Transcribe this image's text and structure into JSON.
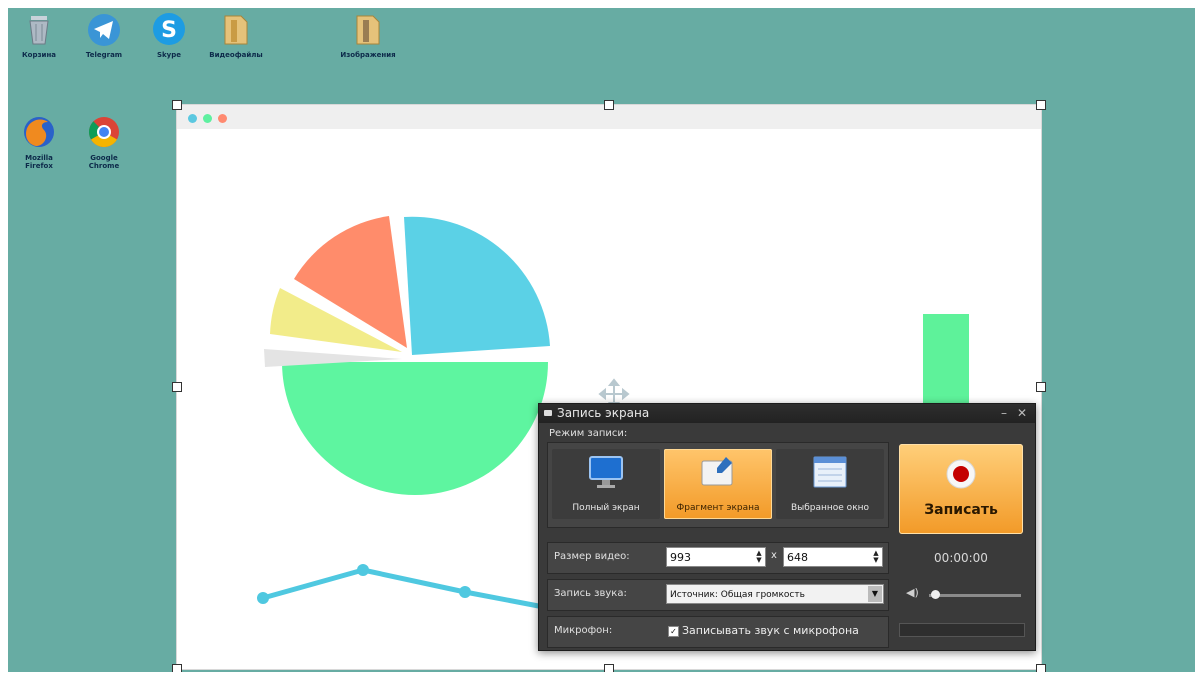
{
  "desktop": {
    "icons": [
      {
        "label": "Корзина",
        "icon": "recycle-bin-icon"
      },
      {
        "label": "Telegram",
        "icon": "telegram-icon"
      },
      {
        "label": "Skype",
        "icon": "skype-icon"
      },
      {
        "label": "Видеофайлы",
        "icon": "folder-icon"
      },
      {
        "label": "Изображения",
        "icon": "folder-icon"
      },
      {
        "label": "Mozilla Firefox",
        "icon": "firefox-icon"
      },
      {
        "label": "Google Chrome",
        "icon": "chrome-icon"
      }
    ]
  },
  "captured_window": {
    "traffic_lights": [
      "#5bc8e0",
      "#5ef0a0",
      "#ff8a70"
    ],
    "pie_colors": [
      "#5bd1e6",
      "#5ef5a0",
      "#eaeaea",
      "#f2ec8a",
      "#ff8c6b"
    ],
    "bar_color": "#5ef29a",
    "line_color": "#4fc8e0"
  },
  "recorder": {
    "title": "Запись экрана",
    "mode_label": "Режим записи:",
    "modes": [
      {
        "label": "Полный экран",
        "icon": "monitor-icon",
        "selected": false
      },
      {
        "label": "Фрагмент экрана",
        "icon": "screen-fragment-icon",
        "selected": true
      },
      {
        "label": "Выбранное окно",
        "icon": "window-icon",
        "selected": false
      }
    ],
    "record_button": "Записать",
    "video_size_label": "Размер видео:",
    "width": "993",
    "height": "648",
    "times_sign": "x",
    "timer": "00:00:00",
    "sound_label": "Запись звука:",
    "sound_source": "Источник: Общая громкость",
    "mic_label": "Микрофон:",
    "mic_checkbox_label": "Записывать звук с микрофона",
    "mic_checked": true,
    "accent": "#f7a531"
  }
}
